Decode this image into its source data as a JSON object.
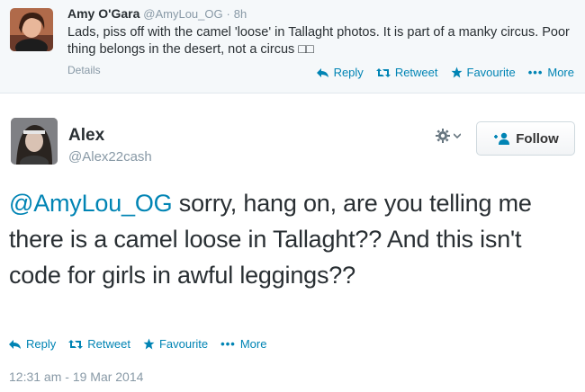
{
  "parent_tweet": {
    "name": "Amy O'Gara",
    "handle": "@AmyLou_OG",
    "separator": "·",
    "time": "8h",
    "text": "Lads, piss off with the camel 'loose' in Tallaght photos. It is part of a manky circus. Poor thing belongs in the desert, not a circus □□",
    "details_label": "Details",
    "actions": {
      "reply": "Reply",
      "retweet": "Retweet",
      "favourite": "Favourite",
      "more": "More"
    }
  },
  "main_tweet": {
    "name": "Alex",
    "handle": "@Alex22cash",
    "follow_label": "Follow",
    "mention": "@AmyLou_OG",
    "text": " sorry, hang on, are you telling me there is a camel loose in Tallaght?? And this isn't code for girls in awful leggings??",
    "actions": {
      "reply": "Reply",
      "retweet": "Retweet",
      "favourite": "Favourite",
      "more": "More"
    },
    "timestamp": "12:31 am - 19 Mar 2014"
  },
  "colors": {
    "link": "#0084b4",
    "muted": "#8899a6",
    "text": "#292f33",
    "parent_bg": "#f5f8fa"
  }
}
